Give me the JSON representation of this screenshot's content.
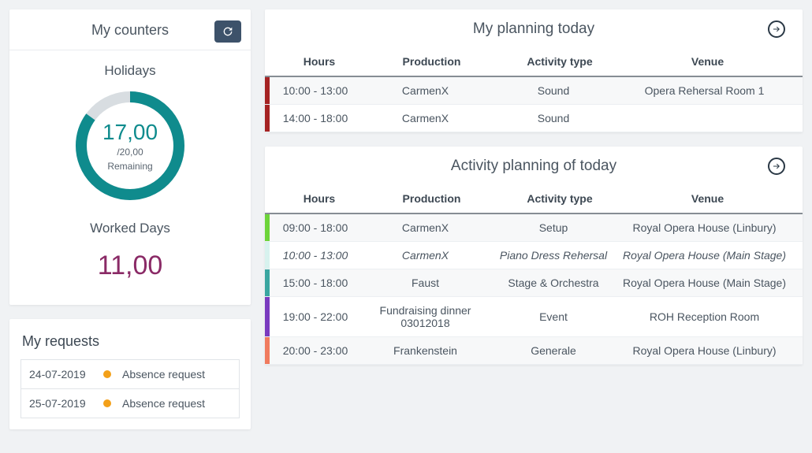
{
  "counters": {
    "title": "My counters",
    "holidays": {
      "label": "Holidays",
      "value": "17,00",
      "max": "/20,00",
      "remaining_label": "Remaining",
      "percent": 85
    },
    "worked_days": {
      "label": "Worked Days",
      "value": "11,00"
    }
  },
  "requests": {
    "title": "My requests",
    "rows": [
      {
        "date": "24-07-2019",
        "label": "Absence request",
        "status_color": "#f3a019"
      },
      {
        "date": "25-07-2019",
        "label": "Absence request",
        "status_color": "#f3a019"
      }
    ]
  },
  "my_planning": {
    "title": "My planning today",
    "columns": {
      "hours": "Hours",
      "production": "Production",
      "activity": "Activity type",
      "venue": "Venue"
    },
    "rows": [
      {
        "accent": "#a52323",
        "hours": "10:00 - 13:00",
        "production": "CarmenX",
        "activity": "Sound",
        "venue": "Opera Rehersal Room 1"
      },
      {
        "accent": "#a52323",
        "hours": "14:00 - 18:00",
        "production": "CarmenX",
        "activity": "Sound",
        "venue": ""
      }
    ]
  },
  "activity_planning": {
    "title": "Activity planning of today",
    "columns": {
      "hours": "Hours",
      "production": "Production",
      "activity": "Activity type",
      "venue": "Venue"
    },
    "rows": [
      {
        "accent": "#6dd43a",
        "hours": "09:00 - 18:00",
        "production": "CarmenX",
        "activity": "Setup",
        "venue": "Royal Opera House (Linbury)",
        "italic": false
      },
      {
        "accent": "#d7f2ee",
        "hours": "10:00 - 13:00",
        "production": "CarmenX",
        "activity": "Piano Dress Rehersal",
        "venue": "Royal Opera House (Main Stage)",
        "italic": true
      },
      {
        "accent": "#3aa6a0",
        "hours": "15:00 - 18:00",
        "production": "Faust",
        "activity": "Stage & Orchestra",
        "venue": "Royal Opera House (Main Stage)",
        "italic": false
      },
      {
        "accent": "#7a3bbf",
        "hours": "19:00 - 22:00",
        "production": "Fundraising dinner 03012018",
        "activity": "Event",
        "venue": "ROH Reception Room",
        "italic": false
      },
      {
        "accent": "#f07b5e",
        "hours": "20:00 - 23:00",
        "production": "Frankenstein",
        "activity": "Generale",
        "venue": "Royal Opera House (Linbury)",
        "italic": false
      }
    ]
  }
}
